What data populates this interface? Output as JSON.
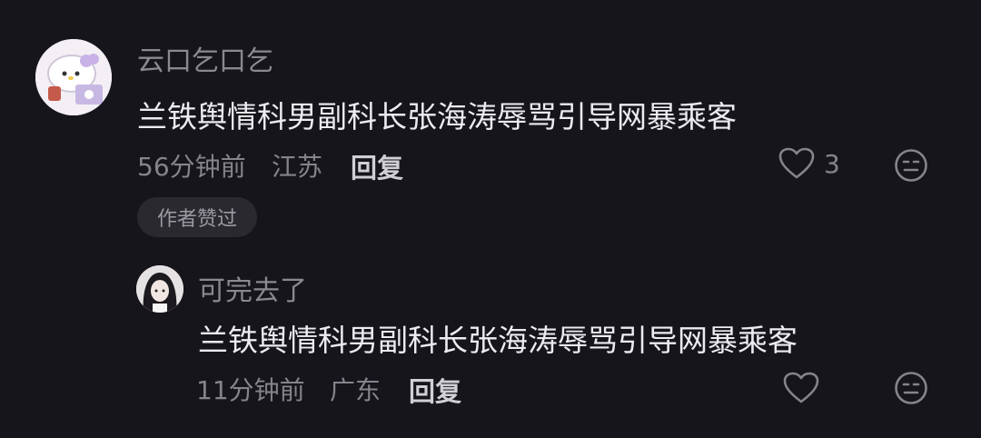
{
  "comments": [
    {
      "username": "云口乞口乞",
      "text": "兰铁舆情科男副科长张海涛辱骂引导网暴乘客",
      "time": "56分钟前",
      "location": "江苏",
      "reply_label": "回复",
      "like_count": "3",
      "badge": "作者赞过"
    },
    {
      "username": "可完去了",
      "text": "兰铁舆情科男副科长张海涛辱骂引导网暴乘客",
      "time": "11分钟前",
      "location": "广东",
      "reply_label": "回复",
      "like_count": ""
    }
  ],
  "icons": {
    "like": "heart-outline-icon",
    "dislike": "neutral-face-icon"
  }
}
